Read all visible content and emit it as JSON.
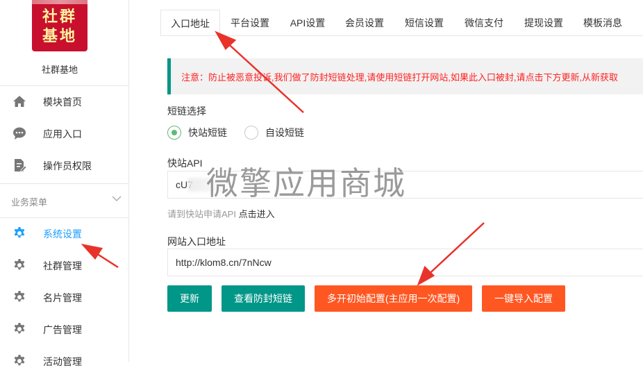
{
  "sidebar": {
    "logo_line1": "社群",
    "logo_line2": "基地",
    "site_name": "社群基地",
    "top_items": [
      {
        "label": "模块首页",
        "icon": "home-icon"
      },
      {
        "label": "应用入口",
        "icon": "chat-icon"
      },
      {
        "label": "操作员权限",
        "icon": "edit-doc-icon"
      }
    ],
    "section_title": "业务菜单",
    "section_icon": "chevron-down-icon",
    "business_items": [
      {
        "label": "系统设置",
        "icon": "gear-icon",
        "active": true
      },
      {
        "label": "社群管理",
        "icon": "gear-icon"
      },
      {
        "label": "名片管理",
        "icon": "gear-icon"
      },
      {
        "label": "广告管理",
        "icon": "gear-icon"
      },
      {
        "label": "活动管理",
        "icon": "gear-icon"
      }
    ]
  },
  "tabs": [
    {
      "label": "入口地址",
      "active": true
    },
    {
      "label": "平台设置"
    },
    {
      "label": "API设置"
    },
    {
      "label": "会员设置"
    },
    {
      "label": "短信设置"
    },
    {
      "label": "微信支付"
    },
    {
      "label": "提现设置"
    },
    {
      "label": "模板消息"
    }
  ],
  "notice": "注意：防止被恶意投诉,我们做了防封短链处理,请使用短链打开网站,如果此入口被封,请点击下方更新,从新获取",
  "short_link": {
    "label": "短链选择",
    "options": [
      {
        "label": "快站短链",
        "checked": true
      },
      {
        "label": "自设短链",
        "checked": false
      }
    ]
  },
  "api": {
    "label": "快站API",
    "value": "cU7"
  },
  "hint": {
    "text": "请到快站申请API ",
    "link": "点击进入"
  },
  "entry": {
    "label": "网站入口地址",
    "value": "http://klom8.cn/7nNcw"
  },
  "buttons": {
    "update": "更新",
    "check": "查看防封短链",
    "multi_init": "多开初始配置(主应用一次配置)",
    "import": "一键导入配置"
  },
  "watermark": "微擎应用商城",
  "colors": {
    "accent_green": "#009688",
    "accent_orange": "#ff5722",
    "active_blue": "#1e9fff",
    "notice_red": "#ff2222",
    "arrow_red": "#e8332b"
  }
}
